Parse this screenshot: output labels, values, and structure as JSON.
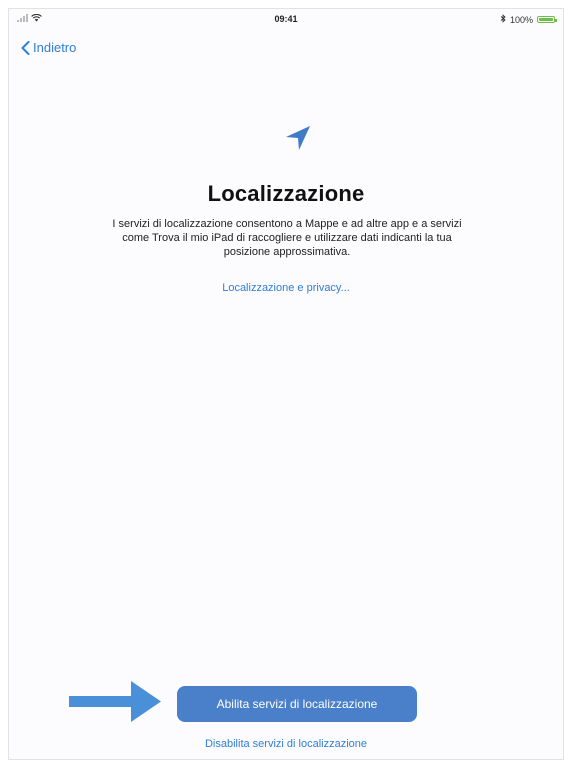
{
  "status_bar": {
    "time": "09:41",
    "battery_percent": "100%",
    "bluetooth_icon": "bluetooth-icon",
    "wifi_icon": "wifi-icon",
    "battery_level": 1.0
  },
  "nav": {
    "back_label": "Indietro"
  },
  "main": {
    "icon": "location-arrow-icon",
    "title": "Localizzazione",
    "description": "I servizi di localizzazione consentono a Mappe e ad altre app e a servizi come Trova il mio iPad di raccogliere e utilizzare dati indicanti la tua posizione approssimativa.",
    "privacy_link": "Localizzazione e privacy..."
  },
  "actions": {
    "enable_label": "Abilita servizi di localizzazione",
    "disable_label": "Disabilita servizi di localizzazione"
  },
  "colors": {
    "accent": "#2f7ed8",
    "button": "#4a7fc9",
    "pointer_arrow": "#4a90d9",
    "battery": "#6cc04a"
  }
}
